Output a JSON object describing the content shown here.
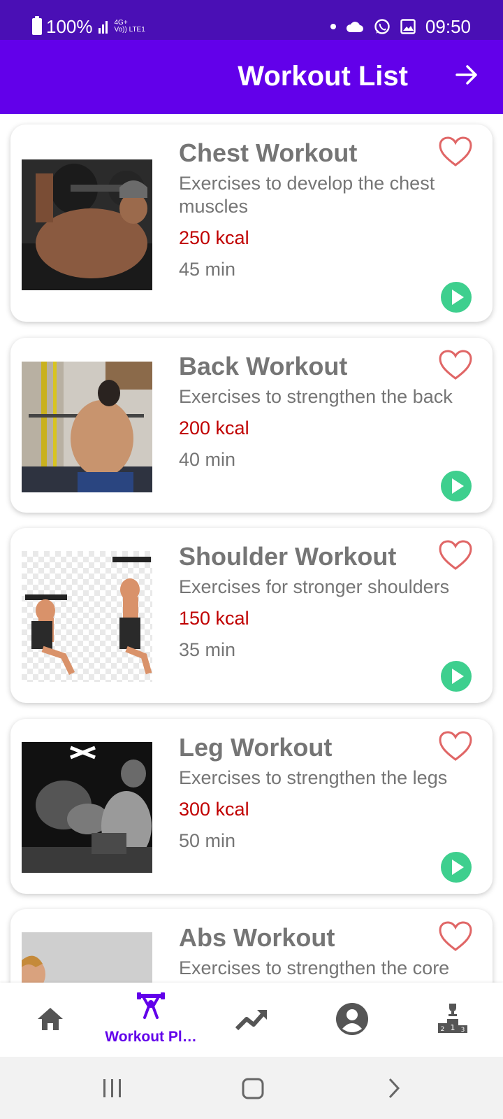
{
  "status_bar": {
    "battery": "100%",
    "network_top": "4G+",
    "network_bottom": "Vo)) LTE1",
    "time": "09:50"
  },
  "header": {
    "title": "Workout List",
    "forward_icon": "arrow-right-icon"
  },
  "workouts": [
    {
      "title": "Chest Workout",
      "description": "Exercises to develop the chest muscles",
      "kcal": "250 kcal",
      "duration": "45 min",
      "image": "chest-press-photo"
    },
    {
      "title": "Back Workout",
      "description": "Exercises to strengthen the back",
      "kcal": "200 kcal",
      "duration": "40 min",
      "image": "lat-pulldown-photo"
    },
    {
      "title": "Shoulder Workout",
      "description": "Exercises for stronger shoulders",
      "kcal": "150 kcal",
      "duration": "35 min",
      "image": "shoulder-press-illustration"
    },
    {
      "title": "Leg Workout",
      "description": "Exercises to strengthen the legs",
      "kcal": "300 kcal",
      "duration": "50 min",
      "image": "leg-press-photo"
    },
    {
      "title": "Abs Workout",
      "description": "Exercises to strengthen the core",
      "kcal": "",
      "duration": "",
      "image": "abs-photo"
    }
  ],
  "bottom_nav": {
    "items": [
      {
        "icon": "home-icon",
        "label": ""
      },
      {
        "icon": "weightlifting-icon",
        "label": "Workout Pl…",
        "active": true
      },
      {
        "icon": "trending-up-icon",
        "label": ""
      },
      {
        "icon": "account-icon",
        "label": ""
      },
      {
        "icon": "leaderboard-podium-icon",
        "label": ""
      }
    ]
  },
  "colors": {
    "status_bar": "#4a0fb5",
    "header": "#6200ea",
    "accent": "#6200ea",
    "kcal": "#c00000",
    "play": "#3ecf8e",
    "heart": "#e06666"
  }
}
